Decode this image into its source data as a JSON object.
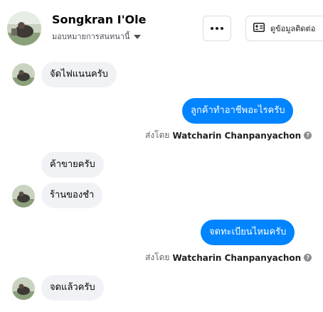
{
  "header": {
    "name": "Songkran I'Ole",
    "subtitle": "มอบหมายการสนทนานี้",
    "more_icon": "more-dots-icon",
    "contact_label": "ดูข้อมูลติดต่อ",
    "contact_icon": "contact-card-icon"
  },
  "messages": [
    {
      "direction": "in",
      "text": "จัดไฟแนนครับ"
    },
    {
      "direction": "out",
      "text": "ลูกค้าทำอาชีพอะไรครับ"
    },
    {
      "direction": "in",
      "text": "ค้าขายครับ"
    },
    {
      "direction": "in",
      "text": "ร้านของชำ"
    },
    {
      "direction": "out",
      "text": "จดทะเบียนไหมครับ"
    },
    {
      "direction": "in",
      "text": "จดแล้วครับ"
    }
  ],
  "sent_by": {
    "prefix": "ส่งโดย",
    "agent": "Watcharin Chanpanyachon",
    "info_icon": "question-icon"
  },
  "colors": {
    "outgoing_bubble": "#0084ff",
    "incoming_bubble": "#f0f2f5"
  }
}
